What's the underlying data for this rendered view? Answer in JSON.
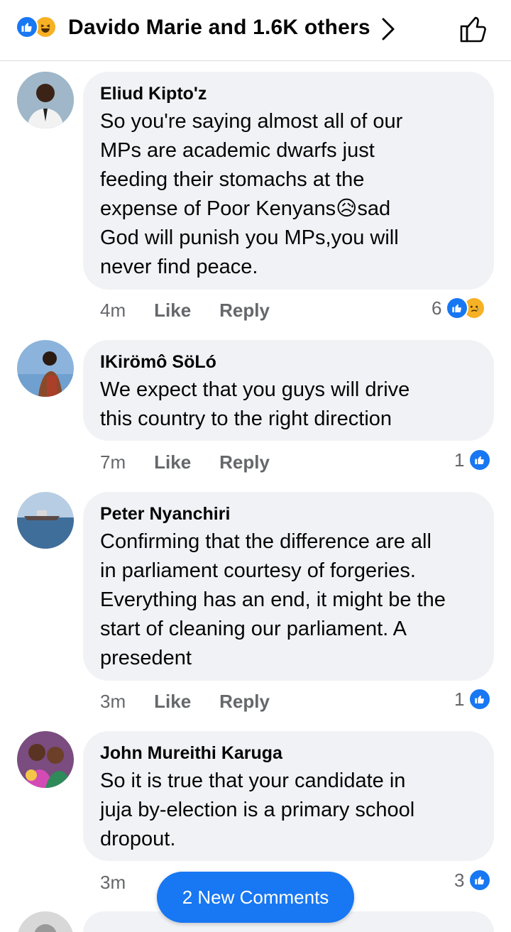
{
  "header": {
    "reactions_text": "Davido Marie and 1.6K others",
    "reaction_icons": [
      "like-icon",
      "haha-icon"
    ]
  },
  "comments": [
    {
      "author": "Eliud Kipto'z",
      "text": "So you're saying almost all of our\nMPs are academic dwarfs just\nfeeding their stomachs at the\nexpense of Poor Kenyans😥sad\nGod will punish you MPs,you will\nnever find peace.",
      "time": "4m",
      "like_label": "Like",
      "reply_label": "Reply",
      "reaction_count": "6",
      "reaction_icons": [
        "like-icon",
        "sad-icon"
      ]
    },
    {
      "author": "IKirömô SöLó",
      "text": "We expect that you guys will drive\nthis country to the right direction",
      "time": "7m",
      "like_label": "Like",
      "reply_label": "Reply",
      "reaction_count": "1",
      "reaction_icons": [
        "like-icon"
      ]
    },
    {
      "author": "Peter Nyanchiri",
      "text": "Confirming that the difference are all\nin parliament courtesy of forgeries.\nEverything has an end, it might be the\nstart of cleaning our parliament. A\npresedent",
      "time": "3m",
      "like_label": "Like",
      "reply_label": "Reply",
      "reaction_count": "1",
      "reaction_icons": [
        "like-icon"
      ]
    },
    {
      "author": "John Mureithi Karuga",
      "text": "So it is true that your candidate in\njuja by-election is a primary school\ndropout.",
      "time": "3m",
      "reaction_count": "3",
      "reaction_icons": [
        "like-icon"
      ]
    }
  ],
  "new_comments_button": "2 New Comments",
  "colors": {
    "accent": "#1877f2",
    "bubble": "#f0f2f5",
    "muted_text": "#65676b"
  }
}
